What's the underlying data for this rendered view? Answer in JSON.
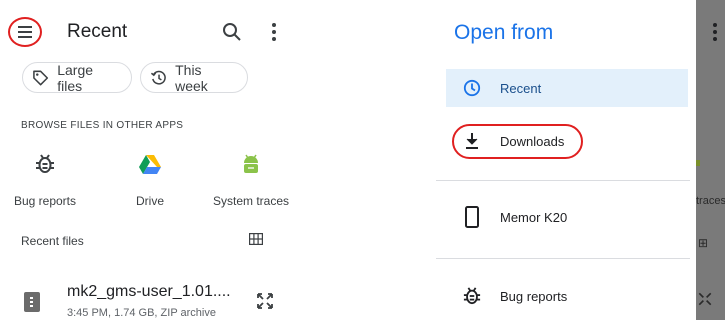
{
  "left": {
    "title": "Recent",
    "chips": [
      {
        "label": "Large files",
        "icon": "tag-icon"
      },
      {
        "label": "This week",
        "icon": "history-icon"
      }
    ],
    "section_title": "BROWSE FILES IN OTHER APPS",
    "apps": [
      {
        "label": "Bug reports",
        "icon": "bug-icon"
      },
      {
        "label": "Drive",
        "icon": "drive-icon"
      },
      {
        "label": "System traces",
        "icon": "android-icon"
      }
    ],
    "recent_files_label": "Recent files",
    "file": {
      "name": "mk2_gms-user_1.01....",
      "meta": "3:45 PM, 1.74 GB, ZIP archive"
    }
  },
  "drawer": {
    "title": "Open from",
    "items": [
      {
        "label": "Recent",
        "icon": "clock-icon",
        "selected": true
      },
      {
        "label": "Downloads",
        "icon": "download-icon"
      },
      {
        "label": "Memor K20",
        "icon": "phone-icon"
      },
      {
        "label": "Bug reports",
        "icon": "bug-icon"
      }
    ],
    "ghost_traces": "traces"
  },
  "colors": {
    "accent": "#1a73e8",
    "selected_bg": "#e3f0fb",
    "highlight_circle": "#e02020",
    "scrim": "#7a7a7a"
  }
}
